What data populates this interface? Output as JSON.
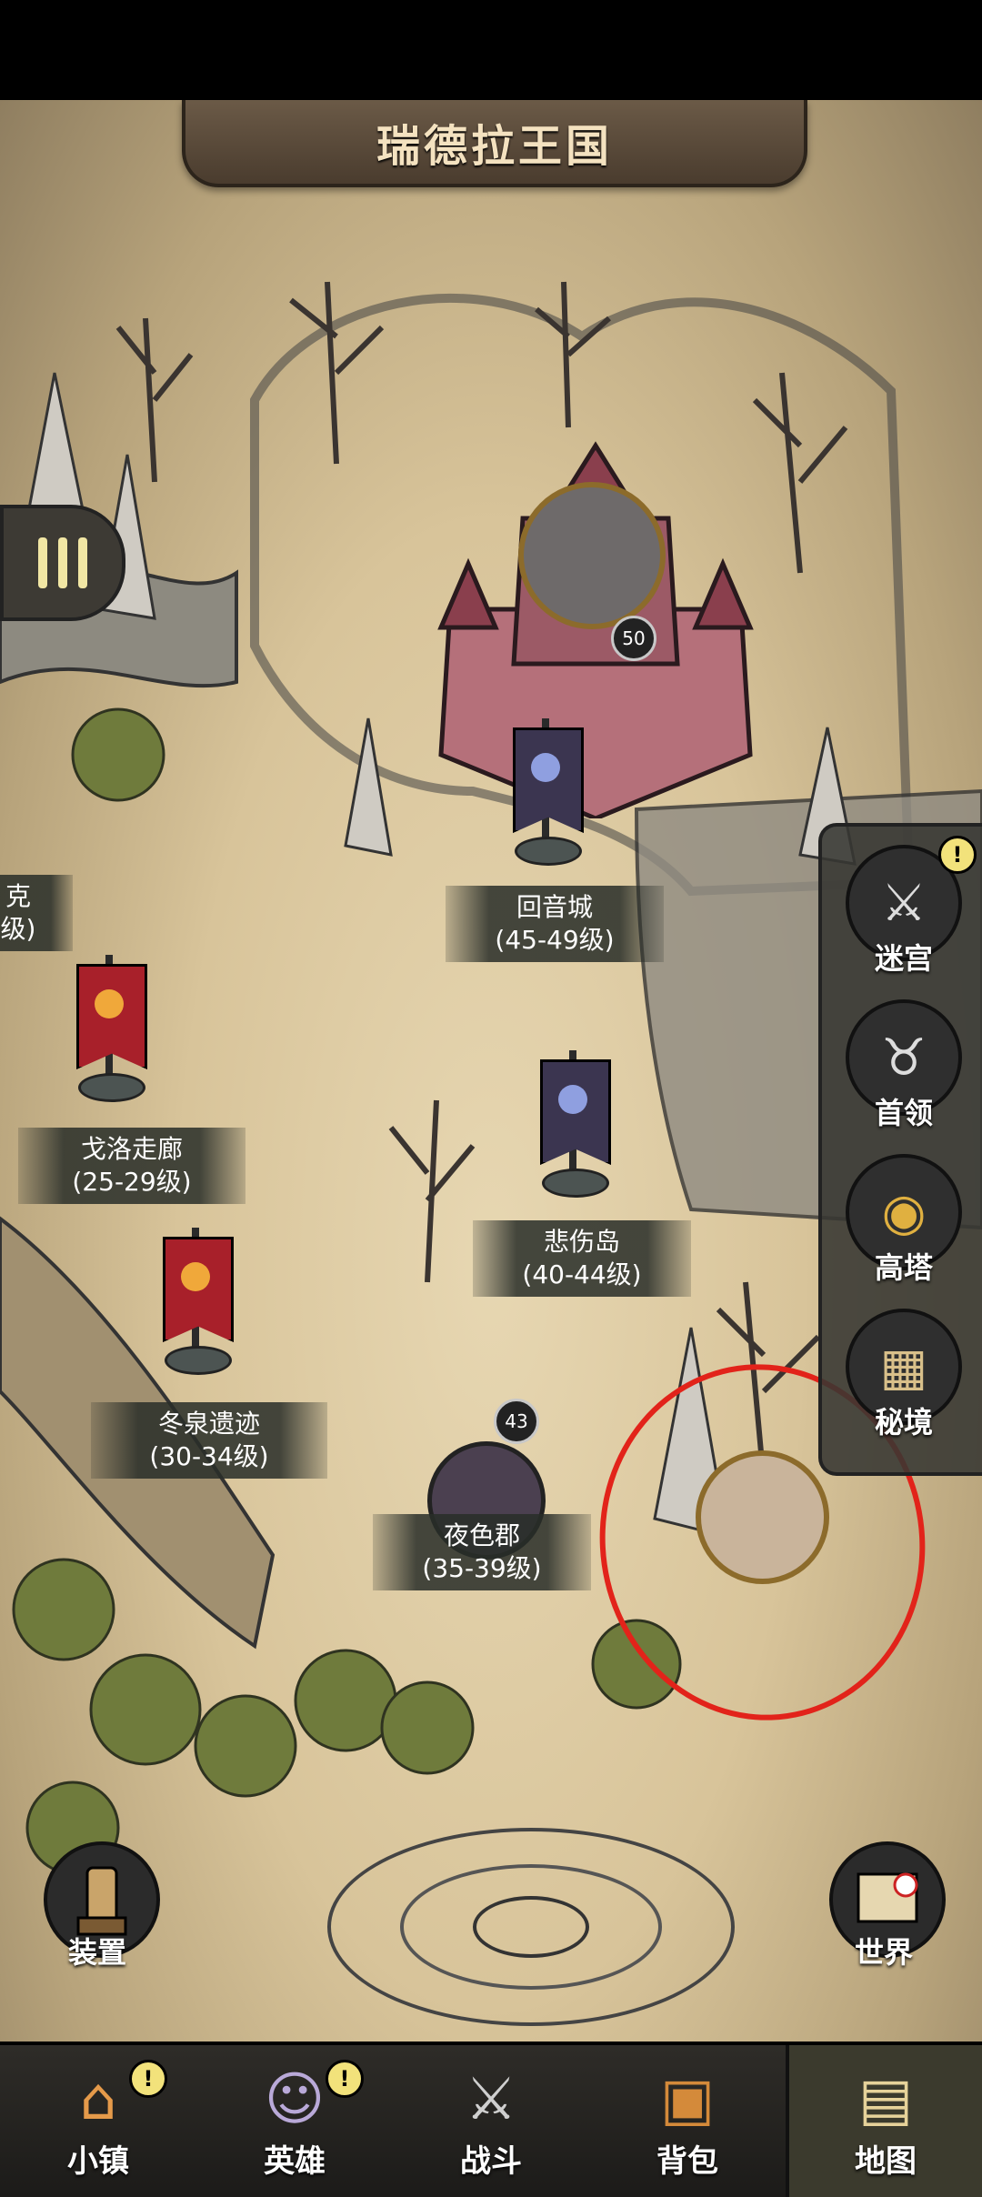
{
  "header": {
    "title": "瑞德拉王国"
  },
  "map": {
    "boss_castle": {
      "level": "50"
    },
    "locations": [
      {
        "name": "回音城",
        "levels": "(45-49级)"
      },
      {
        "name": "戈洛走廊",
        "levels": "(25-29级)"
      },
      {
        "name": "悲伤岛",
        "levels": "(40-44级)"
      },
      {
        "name": "冬泉遗迹",
        "levels": "(30-34级)"
      },
      {
        "name": "夜色郡",
        "levels": "(35-39级)"
      }
    ],
    "partial_left_label": {
      "name": "克",
      "levels": "级)"
    },
    "hero": {
      "level": "43"
    }
  },
  "side_menu": [
    {
      "label": "迷宫",
      "icon": "crossed-swords-icon",
      "alert": "!"
    },
    {
      "label": "首领",
      "icon": "horned-helmet-icon"
    },
    {
      "label": "高塔",
      "icon": "tower-eye-icon"
    },
    {
      "label": "秘境",
      "icon": "arena-icon"
    }
  ],
  "corner_buttons": {
    "equip": {
      "label": "装置",
      "icon": "equipment-icon"
    },
    "world": {
      "label": "世界",
      "icon": "world-map-icon"
    }
  },
  "bottom_nav": [
    {
      "label": "小镇",
      "icon": "house-icon",
      "alert": "!"
    },
    {
      "label": "英雄",
      "icon": "elf-hero-icon",
      "alert": "!"
    },
    {
      "label": "战斗",
      "icon": "battle-swords-icon"
    },
    {
      "label": "背包",
      "icon": "backpack-icon"
    },
    {
      "label": "地图",
      "icon": "map-scroll-icon"
    }
  ],
  "colors": {
    "flag_red": "#a8202a",
    "flag_purple": "#3b3550",
    "highlight_circle": "#e2231a"
  }
}
